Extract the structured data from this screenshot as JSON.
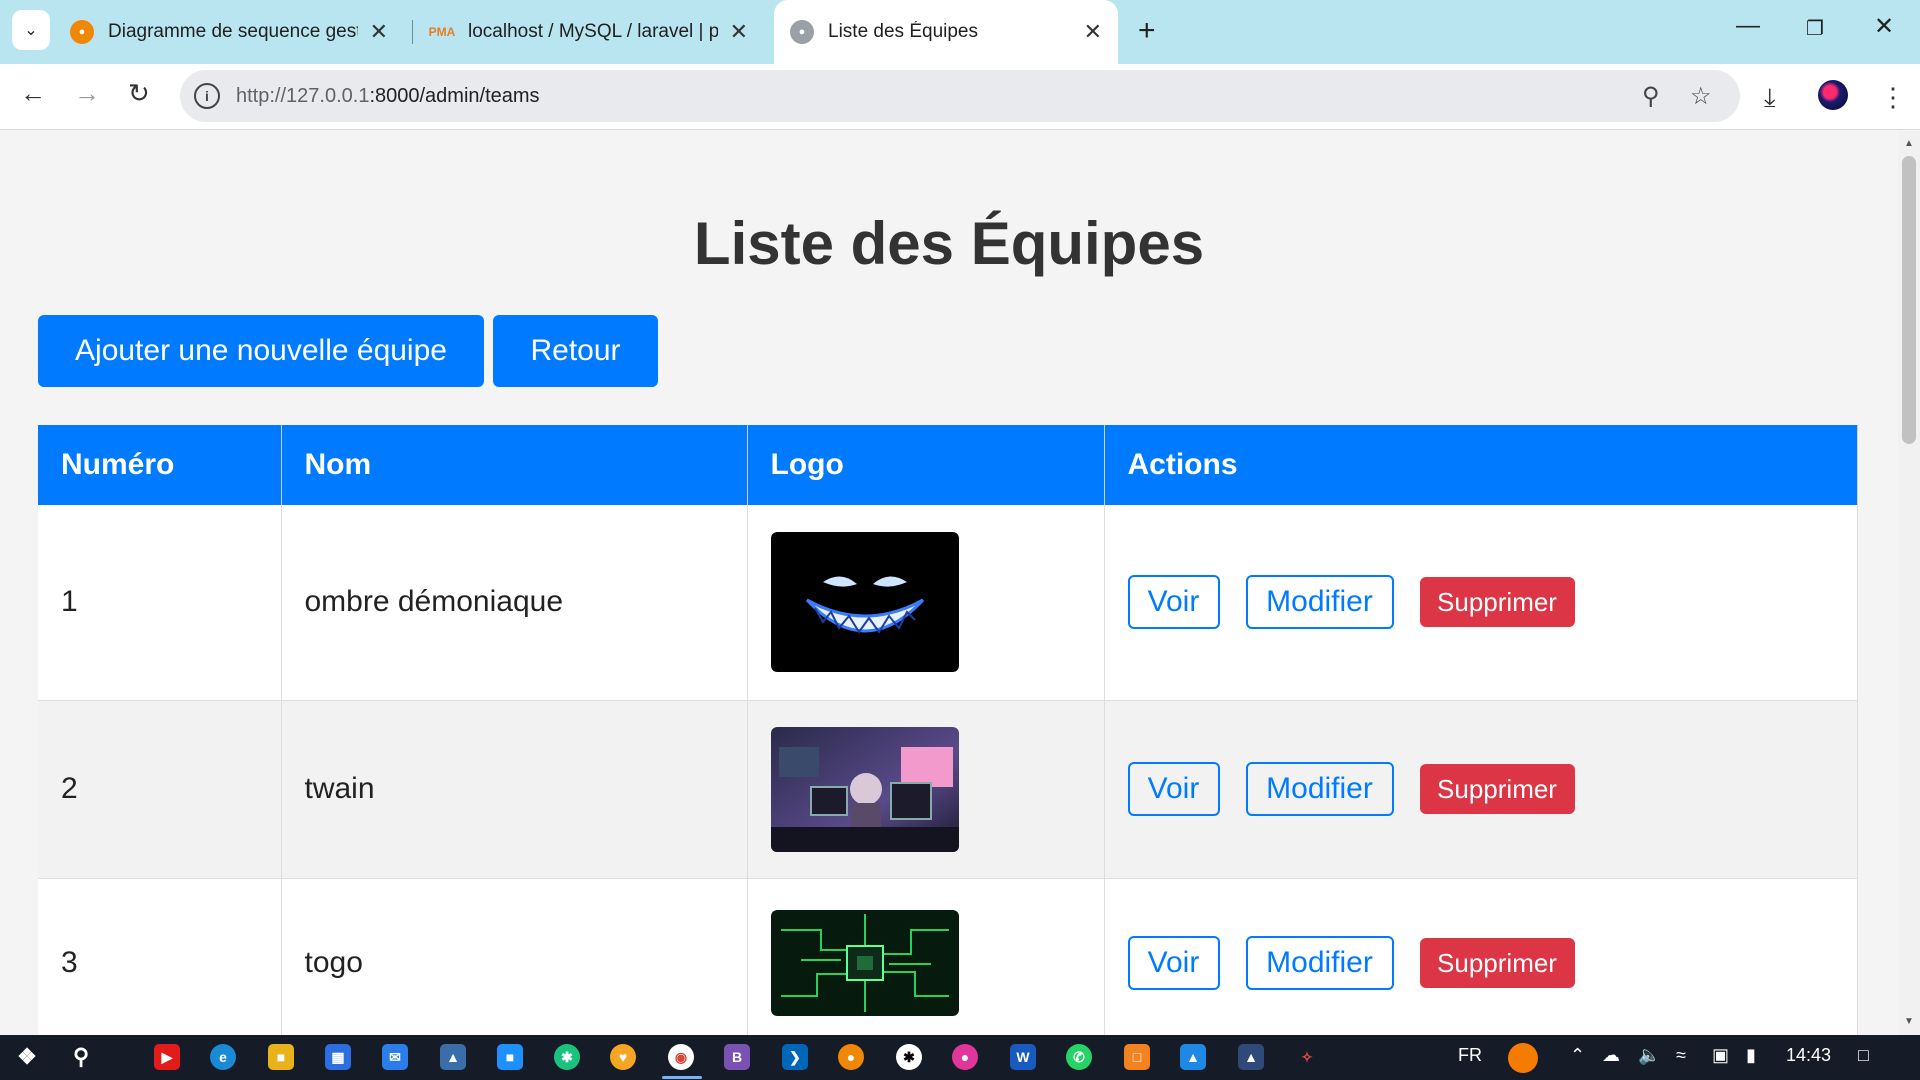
{
  "browser": {
    "tabs": [
      {
        "title": "Diagramme de sequence gestio",
        "favicon": "drawio-icon",
        "active": false
      },
      {
        "title": "localhost / MySQL / laravel | ph",
        "favicon": "phpmyadmin-icon",
        "active": false
      },
      {
        "title": "Liste des Équipes",
        "favicon": "globe-icon",
        "active": true
      }
    ],
    "url_host": "http://127.0.0.1",
    "url_rest": ":8000/admin/teams"
  },
  "page": {
    "title": "Liste des Équipes",
    "add_button": "Ajouter une nouvelle équipe",
    "back_button": "Retour",
    "columns": [
      "Numéro",
      "Nom",
      "Logo",
      "Actions"
    ],
    "rows": [
      {
        "number": "1",
        "name": "ombre démoniaque",
        "logo": "demon-smile-logo"
      },
      {
        "number": "2",
        "name": "twain",
        "logo": "anime-hacker-logo"
      },
      {
        "number": "3",
        "name": "togo",
        "logo": "circuit-board-logo"
      }
    ],
    "actions": {
      "view": "Voir",
      "edit": "Modifier",
      "delete": "Supprimer"
    }
  },
  "taskbar": {
    "language": "FR",
    "time": "14:43"
  },
  "colors": {
    "primary": "#007bff",
    "danger": "#dc3545",
    "tabbar": "#b9e5f1",
    "taskbar": "#161c27"
  }
}
